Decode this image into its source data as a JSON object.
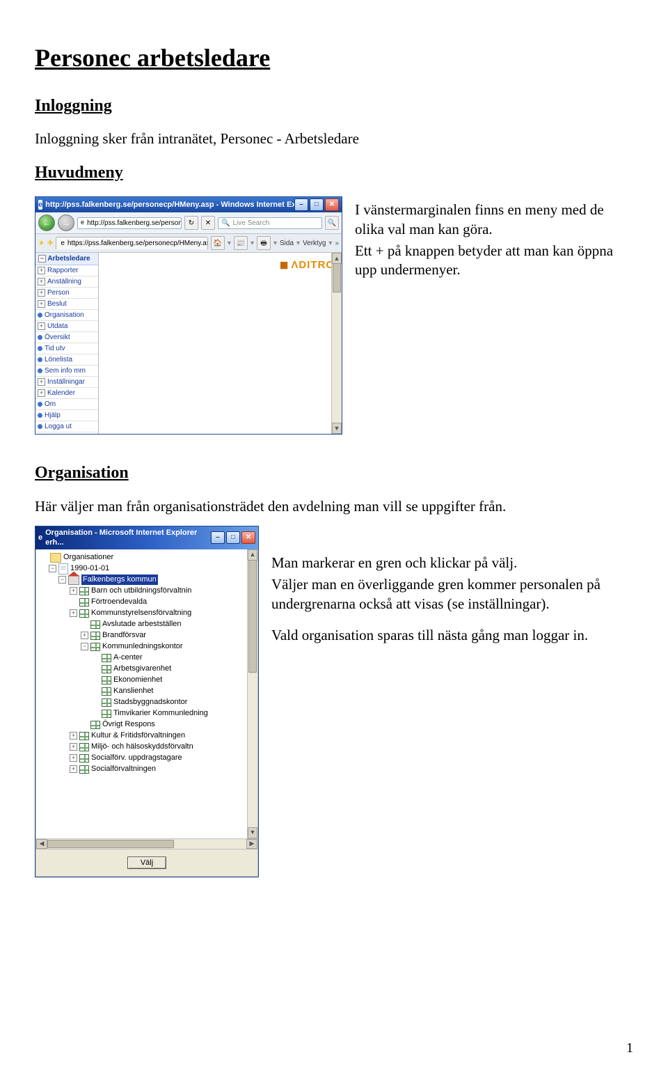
{
  "doc": {
    "title": "Personec arbetsledare",
    "h_inloggning": "Inloggning",
    "p_inloggning": "Inloggning sker från intranätet, Personec - Arbetsledare",
    "h_huvudmeny": "Huvudmeny",
    "p_huvudmeny_1": "I vänstermarginalen finns en meny med de olika val man kan göra.",
    "p_huvudmeny_2": "Ett  +  på knappen betyder att man kan öppna upp undermenyer.",
    "h_org": "Organisation",
    "p_org_intro": "Här väljer man från organisationsträdet den avdelning man vill se uppgifter från.",
    "p_org_1": "Man markerar en gren och klickar på välj.",
    "p_org_2": "Väljer man en överliggande gren kommer personalen på undergrenarna också att visas (se inställningar).",
    "p_org_3": "Vald organisation sparas till nästa gång man loggar in.",
    "page_number": "1"
  },
  "ie": {
    "title": "http://pss.falkenberg.se/personecp/HMeny.asp - Windows Internet Explorer",
    "addr": "http://pss.falkenberg.se/personecp/HMeny.asp",
    "search_placeholder": "Live Search",
    "tab_label": "https://pss.falkenberg.se/personecp/HMeny.asp",
    "tool_sida": "Sida",
    "tool_verktyg": "Verktyg",
    "logo": "ΛDITRO",
    "sidebar_head": "Arbetsledare",
    "sidebar": [
      {
        "exp": "+",
        "label": "Rapporter"
      },
      {
        "exp": "+",
        "label": "Anställning"
      },
      {
        "exp": "+",
        "label": "Person"
      },
      {
        "exp": "+",
        "label": "Beslut"
      },
      {
        "exp": "dot",
        "label": "Organisation"
      },
      {
        "exp": "+",
        "label": "Utdata"
      },
      {
        "exp": "dot",
        "label": "Översikt"
      },
      {
        "exp": "dot",
        "label": "Tid utv"
      },
      {
        "exp": "dot",
        "label": "Lönelista"
      },
      {
        "exp": "dot",
        "label": "Sem info mm"
      },
      {
        "exp": "+",
        "label": "Inställningar"
      },
      {
        "exp": "+",
        "label": "Kalender"
      },
      {
        "exp": "dot",
        "label": "Om"
      },
      {
        "exp": "dot",
        "label": "Hjälp"
      },
      {
        "exp": "dot",
        "label": "Logga ut"
      }
    ]
  },
  "org": {
    "title": "Organisation - Microsoft Internet Explorer erh...",
    "btn_valj": "Välj",
    "tree": [
      {
        "level": 0,
        "icon": "folder",
        "exp": "",
        "label": "Organisationer"
      },
      {
        "level": 1,
        "icon": "page",
        "exp": "-",
        "label": "1990-01-01"
      },
      {
        "level": 2,
        "icon": "house",
        "exp": "-",
        "label": "Falkenbergs kommun",
        "selected": true
      },
      {
        "level": 3,
        "icon": "org",
        "exp": "+",
        "label": "Barn och utbildningsförvaltnin"
      },
      {
        "level": 3,
        "icon": "org",
        "exp": "",
        "label": "Förtroendevalda"
      },
      {
        "level": 3,
        "icon": "org",
        "exp": "+",
        "label": "Kommunstyrelsensförvaltning"
      },
      {
        "level": 4,
        "icon": "org",
        "exp": "",
        "label": "Avslutade arbestställen"
      },
      {
        "level": 4,
        "icon": "org",
        "exp": "+",
        "label": "Brandförsvar"
      },
      {
        "level": 4,
        "icon": "org",
        "exp": "-",
        "label": "Kommunledningskontor"
      },
      {
        "level": 5,
        "icon": "org",
        "exp": "",
        "label": "A-center"
      },
      {
        "level": 5,
        "icon": "org",
        "exp": "",
        "label": "Arbetsgivarenhet"
      },
      {
        "level": 5,
        "icon": "org",
        "exp": "",
        "label": "Ekonomienhet"
      },
      {
        "level": 5,
        "icon": "org",
        "exp": "",
        "label": "Kanslienhet"
      },
      {
        "level": 5,
        "icon": "org",
        "exp": "",
        "label": "Stadsbyggnadskontor"
      },
      {
        "level": 5,
        "icon": "org",
        "exp": "",
        "label": "Timvikarier Kommunledning"
      },
      {
        "level": 4,
        "icon": "org",
        "exp": "",
        "label": "Övrigt Respons"
      },
      {
        "level": 3,
        "icon": "org",
        "exp": "+",
        "label": "Kultur & Fritidsförvaltningen"
      },
      {
        "level": 3,
        "icon": "org",
        "exp": "+",
        "label": "Miljö- och hälsoskyddsförvaltn"
      },
      {
        "level": 3,
        "icon": "org",
        "exp": "+",
        "label": "Socialförv. uppdragstagare"
      },
      {
        "level": 3,
        "icon": "org",
        "exp": "+",
        "label": "Socialförvaltningen"
      }
    ]
  }
}
